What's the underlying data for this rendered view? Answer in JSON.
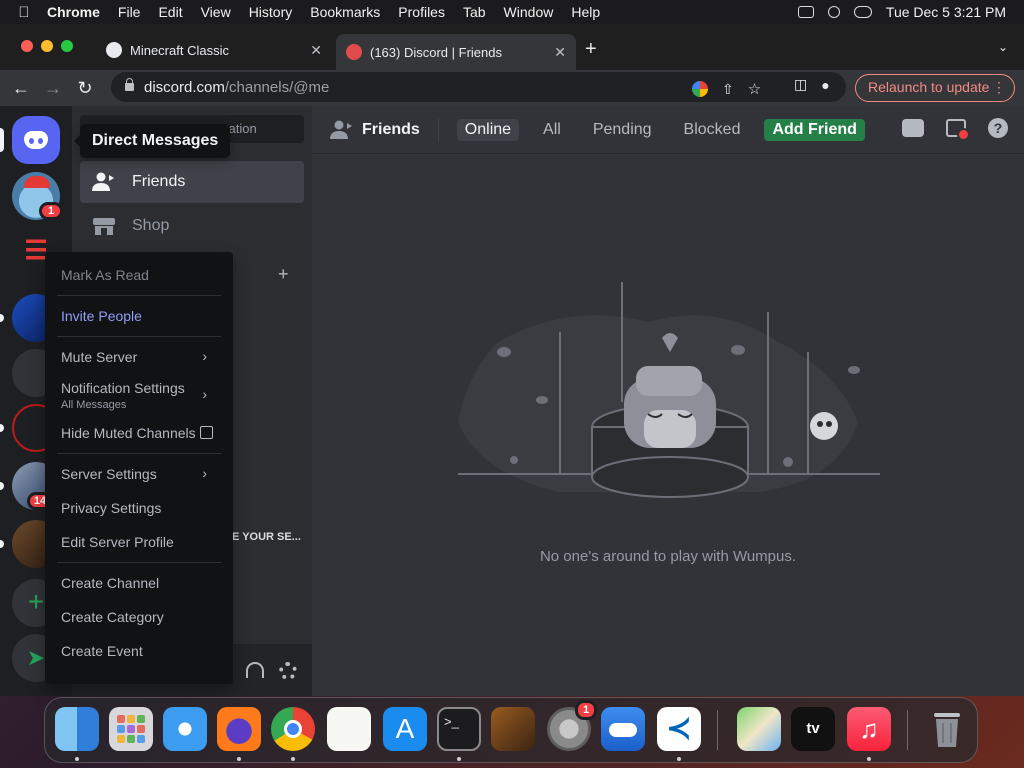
{
  "menubar": {
    "app_name": "Chrome",
    "items": [
      "File",
      "Edit",
      "View",
      "History",
      "Bookmarks",
      "Profiles",
      "Tab",
      "Window",
      "Help"
    ],
    "clock": "Tue Dec 5  3:21 PM"
  },
  "browser": {
    "tabs": [
      {
        "title": "Minecraft Classic",
        "favicon_color": "#e8eaed"
      },
      {
        "title": "(163) Discord | Friends",
        "favicon_color": "#e04c4c",
        "active": true
      }
    ],
    "url_host": "discord.com",
    "url_path": "/channels/@me",
    "relaunch_label": "Relaunch to update"
  },
  "discord": {
    "guild_badges": {
      "server1": "1",
      "server7": "14"
    },
    "dm_search_placeholder": "sation",
    "dm_nav": [
      {
        "label": "Friends",
        "icon": "friends-icon"
      },
      {
        "label": "Shop",
        "icon": "shop-icon"
      }
    ],
    "truncated_server_text": "E YOUR SE...",
    "tooltip": "Direct Messages",
    "header": {
      "title": "Friends",
      "tabs": [
        "Online",
        "All",
        "Pending",
        "Blocked"
      ],
      "selected_tab": "Online",
      "add_friend": "Add Friend"
    },
    "empty_state": "No one's around to play with Wumpus.",
    "context_menu": {
      "mark_as_read": "Mark As Read",
      "invite_people": "Invite People",
      "mute_server": "Mute Server",
      "notification_settings": "Notification Settings",
      "notification_value": "All Messages",
      "hide_muted": "Hide Muted Channels",
      "server_settings": "Server Settings",
      "privacy_settings": "Privacy Settings",
      "edit_server_profile": "Edit Server Profile",
      "create_channel": "Create Channel",
      "create_category": "Create Category",
      "create_event": "Create Event"
    },
    "colors": {
      "blurple": "#5865f2",
      "green": "#248046",
      "red": "#f23f43"
    }
  },
  "dock": {
    "apps": [
      "Finder",
      "Launchpad",
      "Safari",
      "Firefox",
      "Google Chrome",
      "TextEdit",
      "App Store",
      "Terminal",
      "GarageBand",
      "System Settings",
      "Weather",
      "Visual Studio Code",
      "Maps",
      "TV",
      "Music",
      "Trash"
    ],
    "settings_badge": "1",
    "tv_label": "tv"
  }
}
